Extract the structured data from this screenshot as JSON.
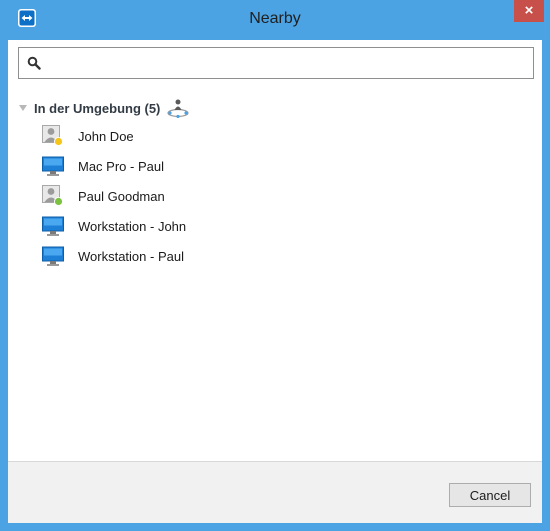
{
  "window": {
    "title": "Nearby",
    "close_label": "×"
  },
  "search": {
    "value": "",
    "placeholder": ""
  },
  "group": {
    "label": "In der Umgebung (5)",
    "expanded": true
  },
  "items": [
    {
      "label": "John Doe",
      "type": "contact",
      "status_color": "#f5c518",
      "icon": "user-contact-icon"
    },
    {
      "label": "Mac Pro - Paul",
      "type": "computer",
      "icon": "computer-monitor-icon"
    },
    {
      "label": "Paul Goodman",
      "type": "contact",
      "status_color": "#7cc242",
      "icon": "user-contact-icon"
    },
    {
      "label": "Workstation - John",
      "type": "computer",
      "icon": "computer-monitor-icon"
    },
    {
      "label": "Workstation - Paul",
      "type": "computer",
      "icon": "computer-monitor-icon"
    }
  ],
  "footer": {
    "cancel_label": "Cancel"
  },
  "colors": {
    "title_bar": "#4ba3e3",
    "close_button": "#c7504a"
  }
}
